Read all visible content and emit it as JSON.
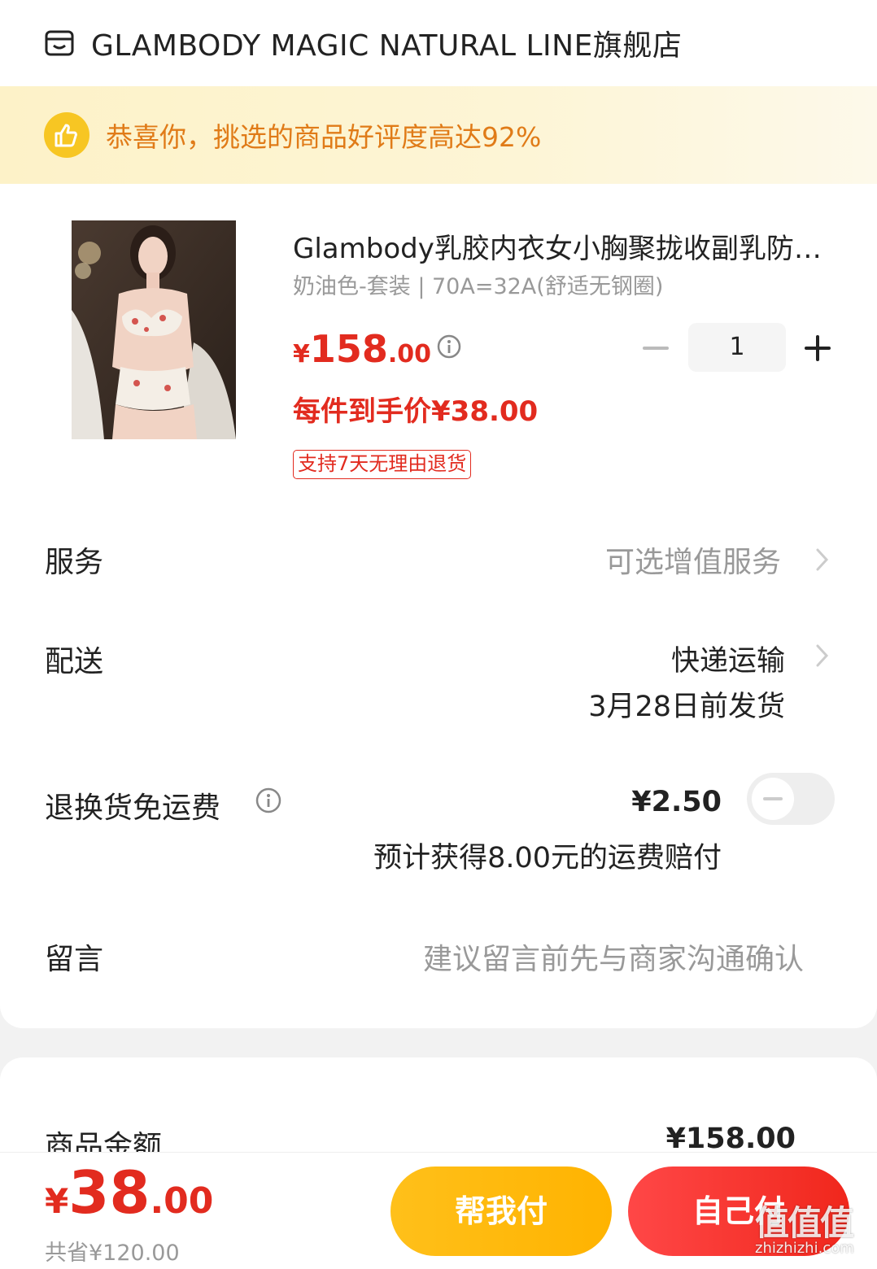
{
  "store": {
    "name": "GLAMBODY MAGIC NATURAL LINE旗舰店",
    "icon": "store-icon"
  },
  "banner": {
    "text": "恭喜你，挑选的商品好评度高达92%",
    "icon": "thumbs-up-icon"
  },
  "product": {
    "title": "Glambody乳胶内衣女小胸聚拢收副乳防下垂",
    "spec": "奶油色-套装 | 70A=32A(舒适无钢圈)",
    "price_symbol": "¥",
    "price_int": "158",
    "price_dec": ".00",
    "per_item_price": "每件到手价¥38.00",
    "return_badge": "支持7天无理由退货",
    "quantity": "1"
  },
  "rows": {
    "service": {
      "label": "服务",
      "value": "可选增值服务"
    },
    "delivery": {
      "label": "配送",
      "value": "快递运输",
      "sub": "3月28日前发货"
    },
    "return_shipping": {
      "label": "退换货免运费",
      "value": "¥2.50",
      "sub": "预计获得8.00元的运费赔付",
      "toggle_on": false
    },
    "message": {
      "label": "留言",
      "placeholder": "建议留言前先与商家沟通确认"
    }
  },
  "summary": {
    "goods_amount_label": "商品金额",
    "goods_amount_value": "¥158.00"
  },
  "bottom": {
    "total_symbol": "¥",
    "total_int": "38",
    "total_dec": ".00",
    "saved": "共省¥120.00",
    "help_pay": "帮我付",
    "self_pay": "自己付"
  },
  "watermark": {
    "text": "值值值",
    "sub": "zhizhizhi.com"
  },
  "colors": {
    "price_red": "#e22b1f",
    "banner_orange": "#e07b18",
    "help_yellow": "#ffb300",
    "pay_red": "#f0271c"
  }
}
